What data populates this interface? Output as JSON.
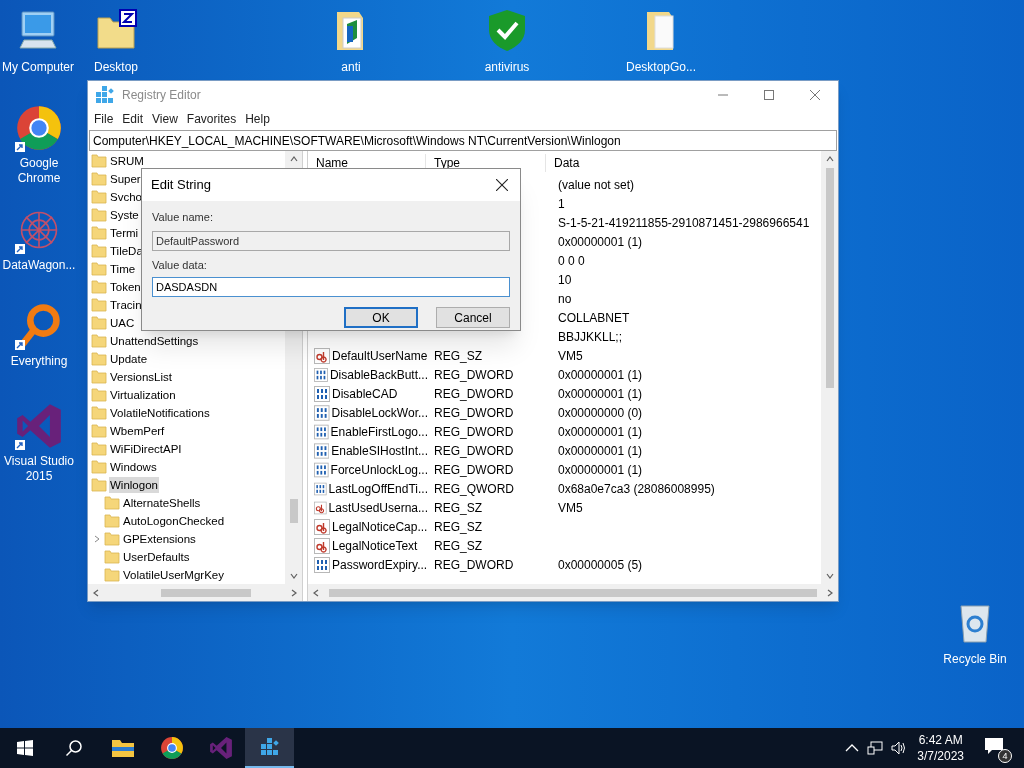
{
  "desktop": {
    "top_icons": [
      {
        "label": "My Computer",
        "kind": "computer"
      },
      {
        "label": "Desktop",
        "kind": "archive"
      },
      {
        "label": "anti",
        "kind": "folder-shield"
      },
      {
        "label": "antivirus",
        "kind": "shield"
      },
      {
        "label": "DesktopGo...",
        "kind": "folder"
      }
    ],
    "left_icons": [
      {
        "label": "Google Chrome",
        "kind": "chrome"
      },
      {
        "label": "DataWagon...",
        "kind": "network"
      },
      {
        "label": "Everything",
        "kind": "magnifier"
      },
      {
        "label": "Visual Studio 2015",
        "kind": "vs"
      }
    ],
    "recycle_bin": {
      "label": "Recycle Bin"
    }
  },
  "window": {
    "title": "Registry Editor",
    "menu": [
      "File",
      "Edit",
      "View",
      "Favorites",
      "Help"
    ],
    "address": "Computer\\HKEY_LOCAL_MACHINE\\SOFTWARE\\Microsoft\\Windows NT\\CurrentVersion\\Winlogon",
    "tree": [
      {
        "label": "SRUM",
        "selected": false
      },
      {
        "label": "Super",
        "selected": false
      },
      {
        "label": "Svcho",
        "selected": false
      },
      {
        "label": "Syste",
        "selected": false
      },
      {
        "label": "Termi",
        "selected": false
      },
      {
        "label": "TileDa",
        "selected": false
      },
      {
        "label": "Time",
        "selected": false
      },
      {
        "label": "Token",
        "selected": false
      },
      {
        "label": "Tracin",
        "selected": false
      },
      {
        "label": "UAC",
        "selected": false
      },
      {
        "label": "UnattendSettings",
        "selected": false
      },
      {
        "label": "Update",
        "selected": false
      },
      {
        "label": "VersionsList",
        "selected": false
      },
      {
        "label": "Virtualization",
        "selected": false
      },
      {
        "label": "VolatileNotifications",
        "selected": false
      },
      {
        "label": "WbemPerf",
        "selected": false
      },
      {
        "label": "WiFiDirectAPI",
        "selected": false
      },
      {
        "label": "Windows",
        "selected": false
      },
      {
        "label": "Winlogon",
        "selected": true,
        "expanded": true,
        "children": [
          {
            "label": "AlternateShells",
            "selected": false
          },
          {
            "label": "AutoLogonChecked",
            "selected": false
          },
          {
            "label": "GPExtensions",
            "selected": false,
            "expanded": false
          },
          {
            "label": "UserDefaults",
            "selected": false
          },
          {
            "label": "VolatileUserMgrKey",
            "selected": false
          }
        ]
      }
    ],
    "columns": [
      "Name",
      "Type",
      "Data"
    ],
    "rows": [
      {
        "data": "(value not set)"
      },
      {
        "data": "1"
      },
      {
        "data": "S-1-5-21-419211855-2910871451-2986966541"
      },
      {
        "data": "0x00000001 (1)"
      },
      {
        "data": "0 0 0"
      },
      {
        "data": "10"
      },
      {
        "data": "no"
      },
      {
        "data": "COLLABNET"
      },
      {
        "data": "BBJJKKLL;;"
      },
      {
        "kind": "sz",
        "name": "DefaultUserName",
        "type": "REG_SZ",
        "data": "VM5"
      },
      {
        "kind": "dword",
        "name": "DisableBackButt...",
        "type": "REG_DWORD",
        "data": "0x00000001 (1)"
      },
      {
        "kind": "dword",
        "name": "DisableCAD",
        "type": "REG_DWORD",
        "data": "0x00000001 (1)"
      },
      {
        "kind": "dword",
        "name": "DisableLockWor...",
        "type": "REG_DWORD",
        "data": "0x00000000 (0)"
      },
      {
        "kind": "dword",
        "name": "EnableFirstLogo...",
        "type": "REG_DWORD",
        "data": "0x00000001 (1)"
      },
      {
        "kind": "dword",
        "name": "EnableSIHostInt...",
        "type": "REG_DWORD",
        "data": "0x00000001 (1)"
      },
      {
        "kind": "dword",
        "name": "ForceUnlockLog...",
        "type": "REG_DWORD",
        "data": "0x00000001 (1)"
      },
      {
        "kind": "dword",
        "name": "LastLogOffEndTi...",
        "type": "REG_QWORD",
        "data": "0x68a0e7ca3 (28086008995)"
      },
      {
        "kind": "sz",
        "name": "LastUsedUserna...",
        "type": "REG_SZ",
        "data": "VM5"
      },
      {
        "kind": "sz",
        "name": "LegalNoticeCap...",
        "type": "REG_SZ"
      },
      {
        "kind": "sz",
        "name": "LegalNoticeText",
        "type": "REG_SZ"
      },
      {
        "kind": "dword",
        "name": "PasswordExpiry...",
        "type": "REG_DWORD",
        "data": "0x00000005 (5)"
      }
    ]
  },
  "dialog": {
    "title": "Edit String",
    "name_label": "Value name:",
    "name_value": "DefaultPassword",
    "data_label": "Value data:",
    "data_value": "DASDASDN",
    "buttons": [
      {
        "label": "OK",
        "default": true
      },
      {
        "label": "Cancel",
        "default": false
      }
    ]
  },
  "taskbar": {
    "items": [
      {
        "kind": "start",
        "active": false
      },
      {
        "kind": "search",
        "active": false
      },
      {
        "kind": "explorer",
        "active": false
      },
      {
        "kind": "chrome",
        "active": false
      },
      {
        "kind": "vs",
        "active": false
      },
      {
        "kind": "regedit",
        "active": true
      }
    ],
    "time": "6:42 AM",
    "date": "3/7/2023",
    "notifications": "4"
  }
}
